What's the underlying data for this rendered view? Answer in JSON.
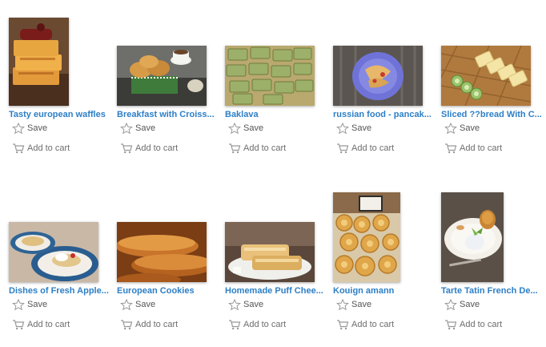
{
  "labels": {
    "save": "Save",
    "add_to_cart": "Add to cart"
  },
  "icons": {
    "save": "star-outline-icon",
    "cart": "shopping-cart-icon"
  },
  "colors": {
    "title_link": "#2d7fc6",
    "action_text": "#555555",
    "icon_stroke": "#999999"
  },
  "items": [
    {
      "title": "Tasty european waffles",
      "image": "waffles-photo"
    },
    {
      "title": "Breakfast with Croiss...",
      "image": "croissants-coffee-photo"
    },
    {
      "title": "Baklava",
      "image": "baklava-photo"
    },
    {
      "title": "russian food - pancak...",
      "image": "pancakes-blue-plate-photo"
    },
    {
      "title": "Sliced ??bread With C...",
      "image": "sliced-bread-cucumber-photo"
    },
    {
      "title": "Dishes of Fresh Apple...",
      "image": "apple-dishes-photo"
    },
    {
      "title": "European Cookies",
      "image": "european-cookies-photo"
    },
    {
      "title": "Homemade Puff Chee...",
      "image": "puff-cheese-pastry-photo"
    },
    {
      "title": "Kouign amann",
      "image": "kouign-amann-photo"
    },
    {
      "title": "Tarte Tatin French De...",
      "image": "tarte-tatin-photo"
    }
  ]
}
